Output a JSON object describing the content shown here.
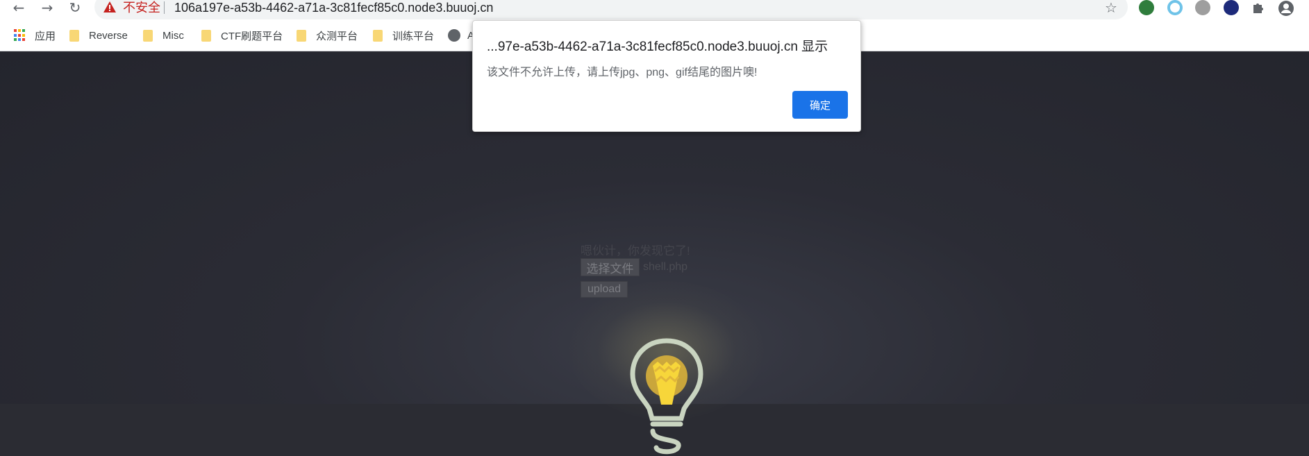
{
  "browser": {
    "security_label": "不安全",
    "url": "106a197e-a53b-4462-a71a-3c81fecf85c0.node3.buuoj.cn"
  },
  "bookmarks": [
    {
      "label": "应用",
      "icon": "apps-grid-icon"
    },
    {
      "label": "Reverse",
      "icon": "folder-icon"
    },
    {
      "label": "Misc",
      "icon": "folder-icon"
    },
    {
      "label": "CTF刷题平台",
      "icon": "folder-icon"
    },
    {
      "label": "众测平台",
      "icon": "folder-icon"
    },
    {
      "label": "训练平台",
      "icon": "folder-icon"
    },
    {
      "label": "A",
      "icon": "globe-icon"
    }
  ],
  "page": {
    "heading": "嗯伙计，你发现它了!",
    "file_button_label": "选择文件",
    "file_name": "shell.php",
    "upload_label": "upload"
  },
  "dialog": {
    "title": "...97e-a53b-4462-a71a-3c81fecf85c0.node3.buuoj.cn 显示",
    "message": "该文件不允许上传，请上传jpg、png、gif结尾的图片噢!",
    "ok_label": "确定"
  },
  "colors": {
    "accent": "#1a73e8",
    "insecure_red": "#c5221f",
    "page_background": "#2b2c33",
    "bulb_yellow": "#f7d63a"
  }
}
